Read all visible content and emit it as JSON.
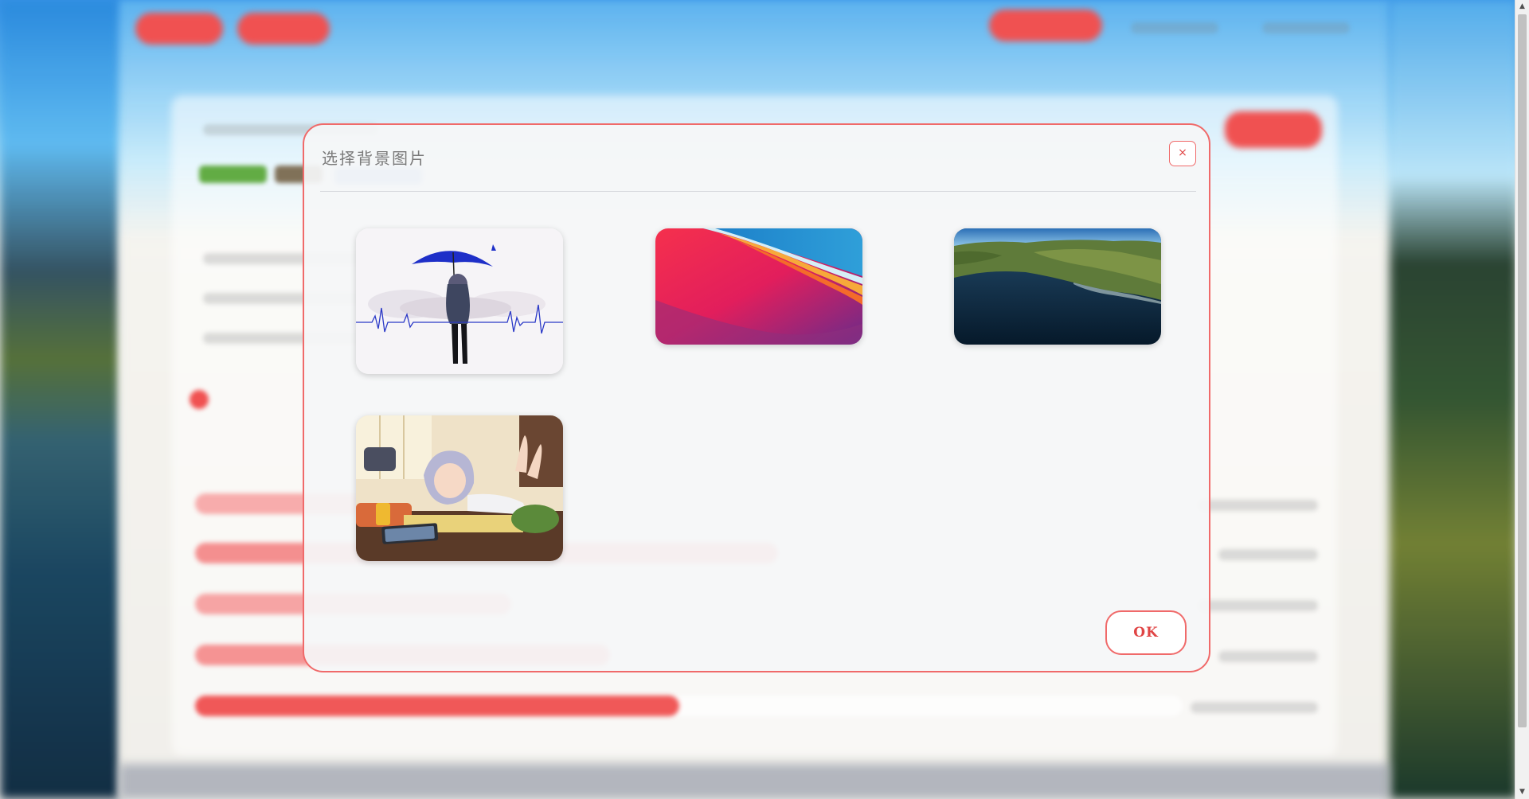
{
  "dialog": {
    "title": "选择背景图片",
    "close_label": "×",
    "ok_label": "OK"
  },
  "wallpapers": [
    {
      "name": "anime-girl-umbrella-heartbeat",
      "selected": false
    },
    {
      "name": "macos-big-sur-gradient",
      "selected": false
    },
    {
      "name": "big-sur-coastline",
      "selected": false
    },
    {
      "name": "anime-girl-lying-on-floor",
      "selected": false
    }
  ],
  "colors": {
    "accent": "#f06a6a",
    "accent_dark": "#e04545",
    "dialog_bg": "#f5f6f8"
  },
  "scrollbar": {
    "up_arrow": "▲",
    "down_arrow": "▼"
  }
}
